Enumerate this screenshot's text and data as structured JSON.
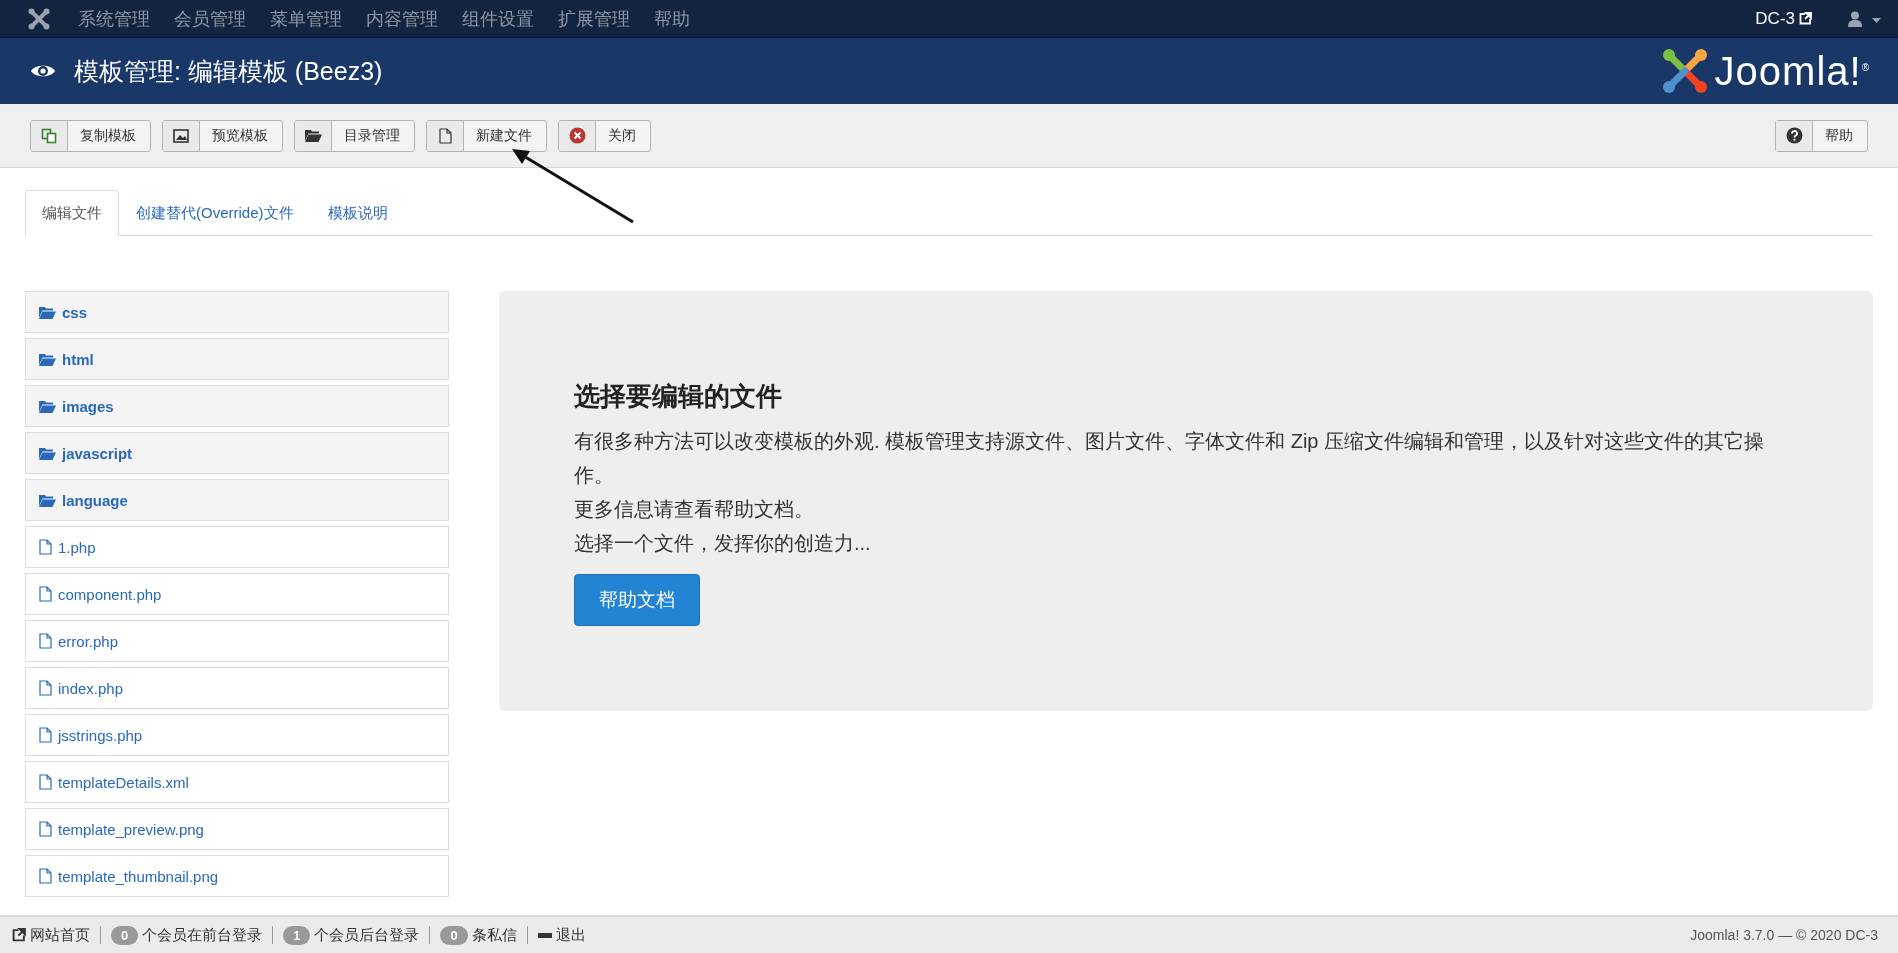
{
  "top_nav": {
    "menu": [
      "系统管理",
      "会员管理",
      "菜单管理",
      "内容管理",
      "组件设置",
      "扩展管理",
      "帮助"
    ],
    "site_link": "DC-3"
  },
  "header": {
    "title": "模板管理: 编辑模板 (Beez3)",
    "logo_text": "Joomla!$^{®}$"
  },
  "toolbar": {
    "buttons": [
      {
        "kind": "copy",
        "label": "复制模板"
      },
      {
        "kind": "image",
        "label": "预览模板"
      },
      {
        "kind": "folder",
        "label": "目录管理"
      },
      {
        "kind": "file",
        "label": "新建文件"
      },
      {
        "kind": "close",
        "label": "关闭"
      }
    ],
    "help_button": {
      "kind": "help",
      "label": "帮助"
    }
  },
  "tabs": [
    {
      "label": "编辑文件",
      "selected": true
    },
    {
      "label": "创建替代(Override)文件",
      "selected": false
    },
    {
      "label": "模板说明",
      "selected": false
    }
  ],
  "files": [
    {
      "kind": "folder",
      "name": "css"
    },
    {
      "kind": "folder",
      "name": "html"
    },
    {
      "kind": "folder",
      "name": "images"
    },
    {
      "kind": "folder",
      "name": "javascript"
    },
    {
      "kind": "folder",
      "name": "language"
    },
    {
      "kind": "file",
      "name": "1.php"
    },
    {
      "kind": "file",
      "name": "component.php"
    },
    {
      "kind": "file",
      "name": "error.php"
    },
    {
      "kind": "file",
      "name": "index.php"
    },
    {
      "kind": "file",
      "name": "jsstrings.php"
    },
    {
      "kind": "file",
      "name": "templateDetails.xml"
    },
    {
      "kind": "file",
      "name": "template_preview.png"
    },
    {
      "kind": "file",
      "name": "template_thumbnail.png"
    }
  ],
  "intro": {
    "heading": "选择要编辑的文件",
    "paragraphs": [
      "有很多种方法可以改变模板的外观. 模板管理支持源文件、图片文件、字体文件和 Zip 压缩文件编辑和管理，以及针对这些文件的其它操作。",
      "更多信息请查看帮助文档。",
      "选择一个文件，发挥你的创造力..."
    ],
    "button": "帮助文档"
  },
  "status_bar": {
    "items": [
      {
        "kind": "link",
        "label": "网站首页"
      },
      {
        "kind": "count",
        "count": "0",
        "label": "个会员在前台登录"
      },
      {
        "kind": "count",
        "count": "1",
        "label": "个会员后台登录"
      },
      {
        "kind": "count",
        "count": "0",
        "label": "条私信"
      },
      {
        "kind": "logout",
        "label": "退出"
      }
    ],
    "copyright": "Joomla! 3.7.0 — © 2020 DC-3"
  }
}
